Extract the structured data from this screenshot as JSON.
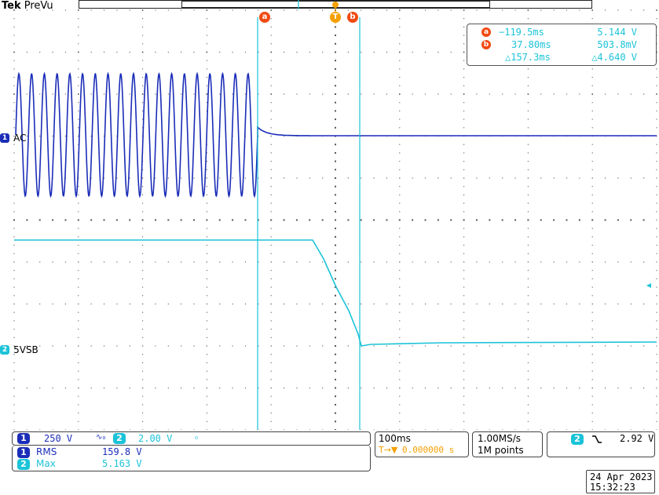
{
  "brand": {
    "maker": "Tek",
    "mode": "PreVu"
  },
  "cursors": {
    "a_label": "a",
    "b_label": "b",
    "trigger_label": "T",
    "readout": {
      "a": {
        "time": "−119.5ms",
        "value": "5.144 V"
      },
      "b": {
        "time": "37.80ms",
        "value": "503.8mV"
      },
      "delta": {
        "time": "△157.3ms",
        "value": "△4.640 V"
      }
    }
  },
  "channels": {
    "ch1": {
      "number": "1",
      "label": "AC",
      "scale": "250 V",
      "coupling_icon": "∿₀",
      "color": "#1b2db8"
    },
    "ch2": {
      "number": "2",
      "label": "5VSB",
      "scale": "2.00 V",
      "coupling_icon": "₀",
      "color": "#1bc3d8"
    }
  },
  "measurements": [
    {
      "channel": "1",
      "name": "RMS",
      "value": "159.8 V"
    },
    {
      "channel": "2",
      "name": "Max",
      "value": "5.163 V"
    }
  ],
  "timebase": {
    "scale": "100ms",
    "trigger_position": "0.000000 s",
    "trigger_prefix": "T→▼"
  },
  "acquisition": {
    "sample_rate": "1.00MS/s",
    "record_length": "1M points"
  },
  "trigger": {
    "channel": "2",
    "slope_icon": "falling-edge",
    "level": "2.92 V"
  },
  "datetime": {
    "date": "24 Apr  2023",
    "time": "15:32:23"
  },
  "colors": {
    "ch1": "#1b2db8",
    "ch2": "#1bc3d8",
    "cursor": "#f04a12",
    "trigger": "#f5a000"
  }
}
